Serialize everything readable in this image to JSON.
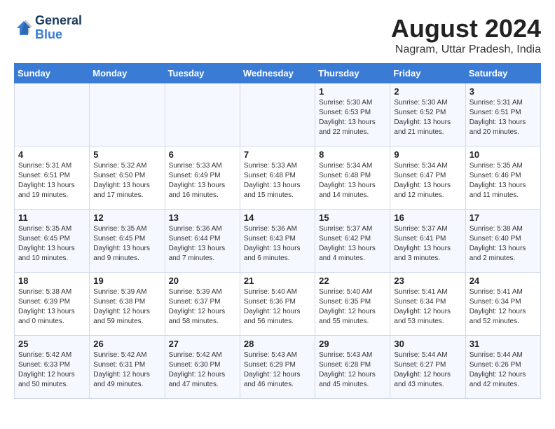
{
  "logo": {
    "line1": "General",
    "line2": "Blue"
  },
  "title": "August 2024",
  "subtitle": "Nagram, Uttar Pradesh, India",
  "headers": [
    "Sunday",
    "Monday",
    "Tuesday",
    "Wednesday",
    "Thursday",
    "Friday",
    "Saturday"
  ],
  "weeks": [
    [
      {
        "day": "",
        "info": ""
      },
      {
        "day": "",
        "info": ""
      },
      {
        "day": "",
        "info": ""
      },
      {
        "day": "",
        "info": ""
      },
      {
        "day": "1",
        "info": "Sunrise: 5:30 AM\nSunset: 6:53 PM\nDaylight: 13 hours\nand 22 minutes."
      },
      {
        "day": "2",
        "info": "Sunrise: 5:30 AM\nSunset: 6:52 PM\nDaylight: 13 hours\nand 21 minutes."
      },
      {
        "day": "3",
        "info": "Sunrise: 5:31 AM\nSunset: 6:51 PM\nDaylight: 13 hours\nand 20 minutes."
      }
    ],
    [
      {
        "day": "4",
        "info": "Sunrise: 5:31 AM\nSunset: 6:51 PM\nDaylight: 13 hours\nand 19 minutes."
      },
      {
        "day": "5",
        "info": "Sunrise: 5:32 AM\nSunset: 6:50 PM\nDaylight: 13 hours\nand 17 minutes."
      },
      {
        "day": "6",
        "info": "Sunrise: 5:33 AM\nSunset: 6:49 PM\nDaylight: 13 hours\nand 16 minutes."
      },
      {
        "day": "7",
        "info": "Sunrise: 5:33 AM\nSunset: 6:48 PM\nDaylight: 13 hours\nand 15 minutes."
      },
      {
        "day": "8",
        "info": "Sunrise: 5:34 AM\nSunset: 6:48 PM\nDaylight: 13 hours\nand 14 minutes."
      },
      {
        "day": "9",
        "info": "Sunrise: 5:34 AM\nSunset: 6:47 PM\nDaylight: 13 hours\nand 12 minutes."
      },
      {
        "day": "10",
        "info": "Sunrise: 5:35 AM\nSunset: 6:46 PM\nDaylight: 13 hours\nand 11 minutes."
      }
    ],
    [
      {
        "day": "11",
        "info": "Sunrise: 5:35 AM\nSunset: 6:45 PM\nDaylight: 13 hours\nand 10 minutes."
      },
      {
        "day": "12",
        "info": "Sunrise: 5:35 AM\nSunset: 6:45 PM\nDaylight: 13 hours\nand 9 minutes."
      },
      {
        "day": "13",
        "info": "Sunrise: 5:36 AM\nSunset: 6:44 PM\nDaylight: 13 hours\nand 7 minutes."
      },
      {
        "day": "14",
        "info": "Sunrise: 5:36 AM\nSunset: 6:43 PM\nDaylight: 13 hours\nand 6 minutes."
      },
      {
        "day": "15",
        "info": "Sunrise: 5:37 AM\nSunset: 6:42 PM\nDaylight: 13 hours\nand 4 minutes."
      },
      {
        "day": "16",
        "info": "Sunrise: 5:37 AM\nSunset: 6:41 PM\nDaylight: 13 hours\nand 3 minutes."
      },
      {
        "day": "17",
        "info": "Sunrise: 5:38 AM\nSunset: 6:40 PM\nDaylight: 13 hours\nand 2 minutes."
      }
    ],
    [
      {
        "day": "18",
        "info": "Sunrise: 5:38 AM\nSunset: 6:39 PM\nDaylight: 13 hours\nand 0 minutes."
      },
      {
        "day": "19",
        "info": "Sunrise: 5:39 AM\nSunset: 6:38 PM\nDaylight: 12 hours\nand 59 minutes."
      },
      {
        "day": "20",
        "info": "Sunrise: 5:39 AM\nSunset: 6:37 PM\nDaylight: 12 hours\nand 58 minutes."
      },
      {
        "day": "21",
        "info": "Sunrise: 5:40 AM\nSunset: 6:36 PM\nDaylight: 12 hours\nand 56 minutes."
      },
      {
        "day": "22",
        "info": "Sunrise: 5:40 AM\nSunset: 6:35 PM\nDaylight: 12 hours\nand 55 minutes."
      },
      {
        "day": "23",
        "info": "Sunrise: 5:41 AM\nSunset: 6:34 PM\nDaylight: 12 hours\nand 53 minutes."
      },
      {
        "day": "24",
        "info": "Sunrise: 5:41 AM\nSunset: 6:34 PM\nDaylight: 12 hours\nand 52 minutes."
      }
    ],
    [
      {
        "day": "25",
        "info": "Sunrise: 5:42 AM\nSunset: 6:33 PM\nDaylight: 12 hours\nand 50 minutes."
      },
      {
        "day": "26",
        "info": "Sunrise: 5:42 AM\nSunset: 6:31 PM\nDaylight: 12 hours\nand 49 minutes."
      },
      {
        "day": "27",
        "info": "Sunrise: 5:42 AM\nSunset: 6:30 PM\nDaylight: 12 hours\nand 47 minutes."
      },
      {
        "day": "28",
        "info": "Sunrise: 5:43 AM\nSunset: 6:29 PM\nDaylight: 12 hours\nand 46 minutes."
      },
      {
        "day": "29",
        "info": "Sunrise: 5:43 AM\nSunset: 6:28 PM\nDaylight: 12 hours\nand 45 minutes."
      },
      {
        "day": "30",
        "info": "Sunrise: 5:44 AM\nSunset: 6:27 PM\nDaylight: 12 hours\nand 43 minutes."
      },
      {
        "day": "31",
        "info": "Sunrise: 5:44 AM\nSunset: 6:26 PM\nDaylight: 12 hours\nand 42 minutes."
      }
    ]
  ],
  "colors": {
    "header_bg": "#3a7bd5",
    "odd_row": "#f0f4ff",
    "even_row": "#ffffff",
    "border": "#c8d4ea"
  }
}
